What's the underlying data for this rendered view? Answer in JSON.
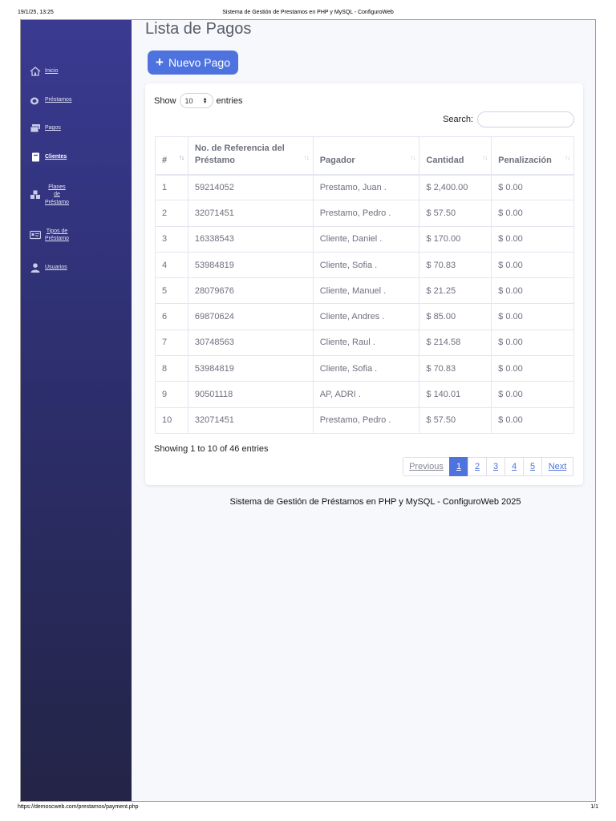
{
  "print": {
    "date": "19/1/25, 13:25",
    "title": "Sistema de Gestión de Prestamos en PHP y MySQL - ConfiguroWeb",
    "url": "https://demoscweb.com/prestamos/payment.php",
    "page": "1/1"
  },
  "sidebar": {
    "items": [
      {
        "label": "Inicio",
        "icon": "home-icon"
      },
      {
        "label": "Préstamos",
        "icon": "coins-icon"
      },
      {
        "label": "Pagos",
        "icon": "money-bill-icon"
      },
      {
        "label": "Clientes",
        "icon": "book-icon",
        "active": true
      },
      {
        "label_lines": [
          "Planes",
          "de",
          "Préstamo"
        ],
        "icon": "cubes-icon"
      },
      {
        "label_lines": [
          "Tipos de",
          "Préstamo"
        ],
        "icon": "id-card-icon"
      },
      {
        "label": "Usuarios",
        "icon": "user-icon"
      }
    ]
  },
  "main": {
    "title": "Lista de Pagos",
    "new_button": "Nuevo Pago",
    "show_label": "Show",
    "entries_value": "10",
    "entries_label": "entries",
    "search_label": "Search:",
    "search_value": "",
    "columns": [
      "#",
      "No. de Referencia del Préstamo",
      "Pagador",
      "Cantidad",
      "Penalización"
    ],
    "rows": [
      [
        "1",
        "59214052",
        "Prestamo, Juan .",
        "$ 2,400.00",
        "$ 0.00"
      ],
      [
        "2",
        "32071451",
        "Prestamo, Pedro .",
        "$ 57.50",
        "$ 0.00"
      ],
      [
        "3",
        "16338543",
        "Cliente, Daniel .",
        "$ 170.00",
        "$ 0.00"
      ],
      [
        "4",
        "53984819",
        "Cliente, Sofia .",
        "$ 70.83",
        "$ 0.00"
      ],
      [
        "5",
        "28079676",
        "Cliente, Manuel .",
        "$ 21.25",
        "$ 0.00"
      ],
      [
        "6",
        "69870624",
        "Cliente, Andres .",
        "$ 85.00",
        "$ 0.00"
      ],
      [
        "7",
        "30748563",
        "Cliente, Raul .",
        "$ 214.58",
        "$ 0.00"
      ],
      [
        "8",
        "53984819",
        "Cliente, Sofia .",
        "$ 70.83",
        "$ 0.00"
      ],
      [
        "9",
        "90501118",
        "AP, ADRI .",
        "$ 140.01",
        "$ 0.00"
      ],
      [
        "10",
        "32071451",
        "Prestamo, Pedro .",
        "$ 57.50",
        "$ 0.00"
      ]
    ],
    "info": "Showing 1 to 10 of 46 entries",
    "pagination": {
      "previous": "Previous",
      "pages": [
        "1",
        "2",
        "3",
        "4",
        "5"
      ],
      "active": "1",
      "next": "Next"
    },
    "footer": "Sistema de Gestión de Préstamos en PHP y MySQL - ConfiguroWeb 2025"
  },
  "colors": {
    "primary": "#4e73df",
    "sidebar_top": "#3a3a92",
    "sidebar_bottom": "#232446"
  }
}
